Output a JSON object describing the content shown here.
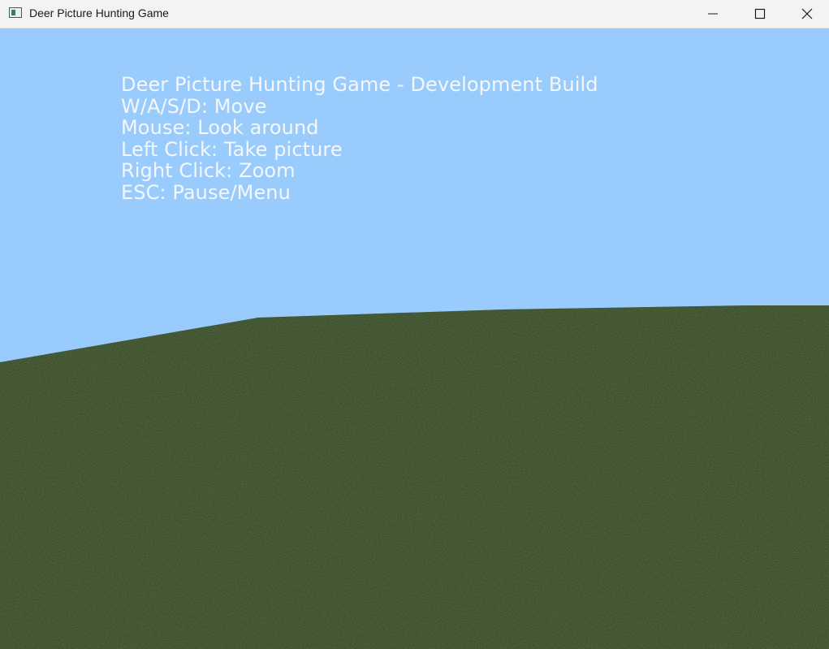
{
  "window": {
    "title": "Deer Picture Hunting Game",
    "controls": {
      "minimize_icon": "minimize-icon",
      "maximize_icon": "maximize-icon",
      "close_icon": "close-icon"
    }
  },
  "scene": {
    "sky_color": "#99cbfc",
    "ground_color": "#2e4020"
  },
  "hud": {
    "lines": [
      "Deer Picture Hunting Game - Development Build",
      "W/A/S/D: Move",
      "Mouse: Look around",
      "Left Click: Take picture",
      "Right Click: Zoom",
      "ESC: Pause/Menu"
    ]
  }
}
